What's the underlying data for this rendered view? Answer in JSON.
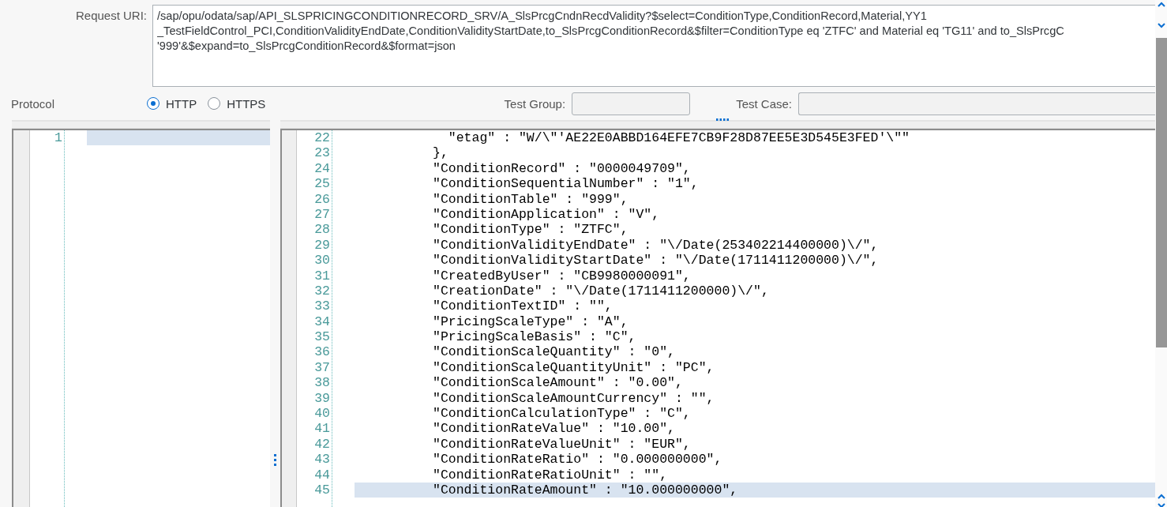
{
  "request_uri": {
    "label": "Request URI:",
    "lines": [
      "/sap/opu/odata/sap/API_SLSPRICINGCONDITIONRECORD_SRV/A_SlsPrcgCndnRecdValidity?$select=ConditionType,ConditionRecord,Material,YY1",
      "_TestFieldControl_PCI,ConditionValidityEndDate,ConditionValidityStartDate,to_SlsPrcgConditionRecord&$filter=ConditionType eq 'ZTFC' and Material eq 'TG11' and to_SlsPrcgC",
      "'999'&$expand=to_SlsPrcgConditionRecord&$format=json"
    ]
  },
  "protocol": {
    "label": "Protocol",
    "options": [
      {
        "label": "HTTP",
        "selected": true
      },
      {
        "label": "HTTPS",
        "selected": false
      }
    ]
  },
  "test_group": {
    "label": "Test Group:"
  },
  "test_case": {
    "label": "Test Case:"
  },
  "request_editor": {
    "lines": [
      {
        "number": "1",
        "highlighted": true
      }
    ]
  },
  "response_editor": {
    "lines": [
      {
        "number": "22",
        "text": "            \"etag\" : \"W/\\\"'AE22E0ABBD164EFE7CB9F28D87EE5E3D545E3FED'\\\"\"",
        "highlighted": false
      },
      {
        "number": "23",
        "text": "          },",
        "highlighted": false
      },
      {
        "number": "24",
        "text": "          \"ConditionRecord\" : \"0000049709\",",
        "highlighted": false
      },
      {
        "number": "25",
        "text": "          \"ConditionSequentialNumber\" : \"1\",",
        "highlighted": false
      },
      {
        "number": "26",
        "text": "          \"ConditionTable\" : \"999\",",
        "highlighted": false
      },
      {
        "number": "27",
        "text": "          \"ConditionApplication\" : \"V\",",
        "highlighted": false
      },
      {
        "number": "28",
        "text": "          \"ConditionType\" : \"ZTFC\",",
        "highlighted": false
      },
      {
        "number": "29",
        "text": "          \"ConditionValidityEndDate\" : \"\\/Date(253402214400000)\\/\",",
        "highlighted": false
      },
      {
        "number": "30",
        "text": "          \"ConditionValidityStartDate\" : \"\\/Date(1711411200000)\\/\",",
        "highlighted": false
      },
      {
        "number": "31",
        "text": "          \"CreatedByUser\" : \"CB9980000091\",",
        "highlighted": false
      },
      {
        "number": "32",
        "text": "          \"CreationDate\" : \"\\/Date(1711411200000)\\/\",",
        "highlighted": false
      },
      {
        "number": "33",
        "text": "          \"ConditionTextID\" : \"\",",
        "highlighted": false
      },
      {
        "number": "34",
        "text": "          \"PricingScaleType\" : \"A\",",
        "highlighted": false
      },
      {
        "number": "35",
        "text": "          \"PricingScaleBasis\" : \"C\",",
        "highlighted": false
      },
      {
        "number": "36",
        "text": "          \"ConditionScaleQuantity\" : \"0\",",
        "highlighted": false
      },
      {
        "number": "37",
        "text": "          \"ConditionScaleQuantityUnit\" : \"PC\",",
        "highlighted": false
      },
      {
        "number": "38",
        "text": "          \"ConditionScaleAmount\" : \"0.00\",",
        "highlighted": false
      },
      {
        "number": "39",
        "text": "          \"ConditionScaleAmountCurrency\" : \"\",",
        "highlighted": false
      },
      {
        "number": "40",
        "text": "          \"ConditionCalculationType\" : \"C\",",
        "highlighted": false
      },
      {
        "number": "41",
        "text": "          \"ConditionRateValue\" : \"10.00\",",
        "highlighted": false
      },
      {
        "number": "42",
        "text": "          \"ConditionRateValueUnit\" : \"EUR\",",
        "highlighted": false
      },
      {
        "number": "43",
        "text": "          \"ConditionRateRatio\" : \"0.000000000\",",
        "highlighted": false
      },
      {
        "number": "44",
        "text": "          \"ConditionRateRatioUnit\" : \"\",",
        "highlighted": false
      },
      {
        "number": "45",
        "text": "          \"ConditionRateAmount\" : \"10.000000000\",",
        "highlighted": true
      }
    ]
  }
}
